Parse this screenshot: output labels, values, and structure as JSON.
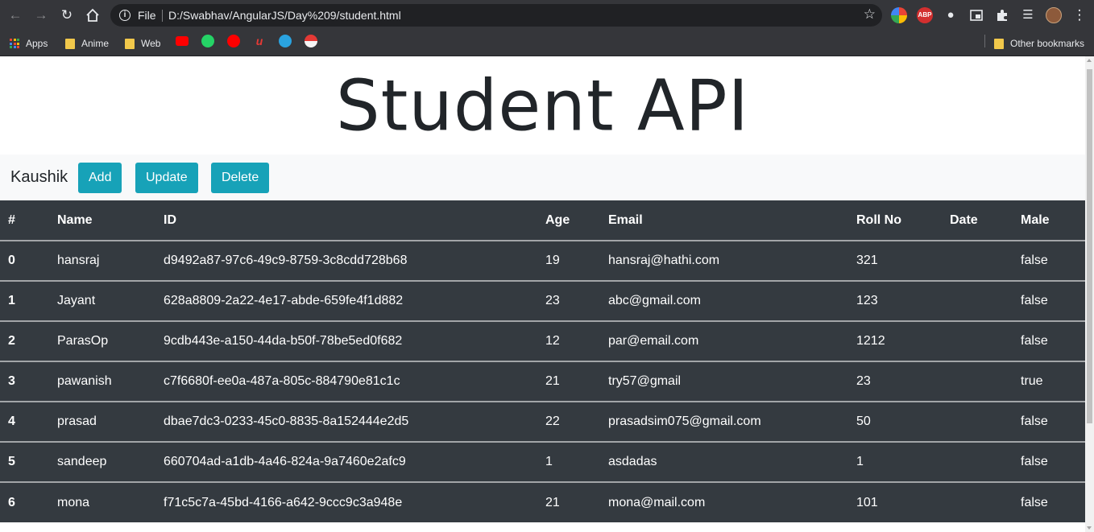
{
  "browser": {
    "file_label": "File",
    "url": "D:/Swabhav/AngularJS/Day%209/student.html",
    "bookmarks": [
      {
        "label": "Apps",
        "icon": "apps-grid-icon"
      },
      {
        "label": "Anime",
        "icon": "folder-icon"
      },
      {
        "label": "Web",
        "icon": "folder-icon"
      }
    ],
    "other_bookmarks": "Other bookmarks",
    "extensions": [
      "color-picker-icon",
      "abp-icon",
      "group-icon",
      "picture-in-picture-icon",
      "puzzle-icon",
      "media-queue-icon",
      "profile-avatar-icon"
    ],
    "abp_text": "ABP"
  },
  "page": {
    "title": "Student API",
    "brand": "Kaushik",
    "buttons": {
      "add": "Add",
      "update": "Update",
      "delete": "Delete"
    },
    "button_color": "#17a2b8",
    "table_bg": "#343a40"
  },
  "table": {
    "headers": [
      "#",
      "Name",
      "ID",
      "Age",
      "Email",
      "Roll No",
      "Date",
      "Male"
    ],
    "rows": [
      [
        "0",
        "hansraj",
        "d9492a87-97c6-49c9-8759-3c8cdd728b68",
        "19",
        "hansraj@hathi.com",
        "321",
        "",
        "false"
      ],
      [
        "1",
        "Jayant",
        "628a8809-2a22-4e17-abde-659fe4f1d882",
        "23",
        "abc@gmail.com",
        "123",
        "",
        "false"
      ],
      [
        "2",
        "ParasOp",
        "9cdb443e-a150-44da-b50f-78be5ed0f682",
        "12",
        "par@email.com",
        "1212",
        "",
        "false"
      ],
      [
        "3",
        "pawanish",
        "c7f6680f-ee0a-487a-805c-884790e81c1c",
        "21",
        "try57@gmail",
        "23",
        "",
        "true"
      ],
      [
        "4",
        "prasad",
        "dbae7dc3-0233-45c0-8835-8a152444e2d5",
        "22",
        "prasadsim075@gmail.com",
        "50",
        "",
        "false"
      ],
      [
        "5",
        "sandeep",
        "660704ad-a1db-4a46-824a-9a7460e2afc9",
        "1",
        "asdadas",
        "1",
        "",
        "false"
      ],
      [
        "6",
        "mona",
        "f71c5c7a-45bd-4166-a642-9ccc9c3a948e",
        "21",
        "mona@mail.com",
        "101",
        "",
        "false"
      ]
    ]
  }
}
